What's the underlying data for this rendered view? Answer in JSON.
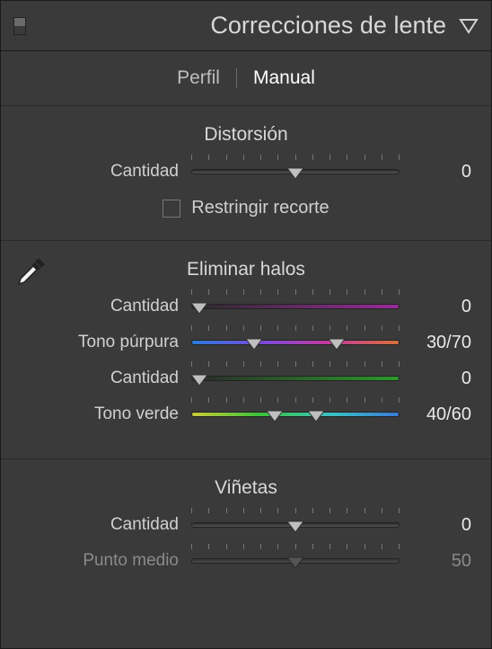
{
  "panel": {
    "title": "Correcciones de lente"
  },
  "tabs": {
    "profile": "Perfil",
    "manual": "Manual"
  },
  "distortion": {
    "title": "Distorsión",
    "amount_label": "Cantidad",
    "amount_value": "0",
    "constrain_label": "Restringir recorte"
  },
  "defringe": {
    "title": "Eliminar halos",
    "purple_amount_label": "Cantidad",
    "purple_amount_value": "0",
    "purple_hue_label": "Tono púrpura",
    "purple_hue_value": "30/70",
    "green_amount_label": "Cantidad",
    "green_amount_value": "0",
    "green_hue_label": "Tono verde",
    "green_hue_value": "40/60"
  },
  "vignette": {
    "title": "Viñetas",
    "amount_label": "Cantidad",
    "amount_value": "0",
    "midpoint_label": "Punto medio",
    "midpoint_value": "50"
  }
}
